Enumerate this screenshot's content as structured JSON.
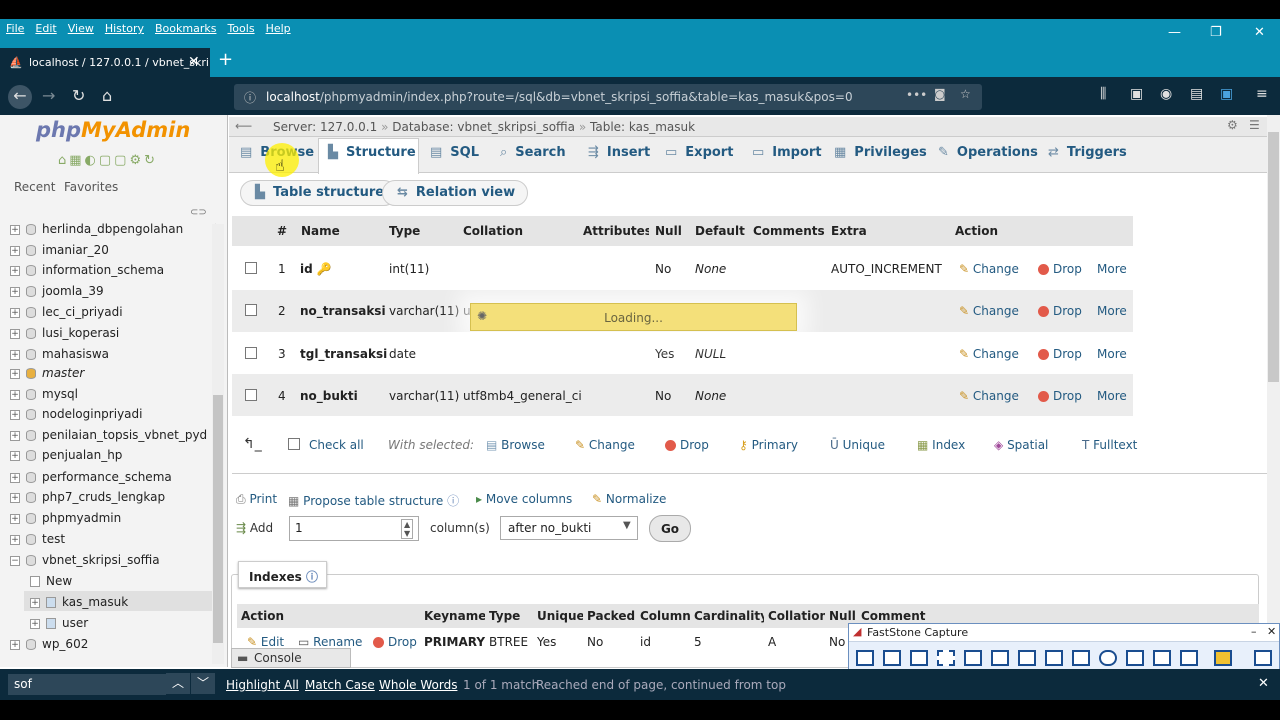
{
  "menu": [
    "File",
    "Edit",
    "View",
    "History",
    "Bookmarks",
    "Tools",
    "Help"
  ],
  "tab_title": "localhost / 127.0.0.1 / vbnet_skripsi_soffia",
  "url_host": "localhost",
  "url_path": "/phpmyadmin/index.php?route=/sql&db=vbnet_skripsi_soffia&table=kas_masuk&pos=0",
  "logo": {
    "php": "php",
    "my": "MyAdmin"
  },
  "sidebar": {
    "recent": "Recent",
    "favorites": "Favorites",
    "dbs": [
      "herlinda_dbpengolahan",
      "imaniar_20",
      "information_schema",
      "joomla_39",
      "lec_ci_priyadi",
      "lusi_koperasi",
      "mahasiswa",
      "master",
      "mysql",
      "nodeloginpriyadi",
      "penilaian_topsis_vbnet_pyd",
      "penjualan_hp",
      "performance_schema",
      "php7_cruds_lengkap",
      "phpmyadmin",
      "test",
      "vbnet_skripsi_soffia",
      "New",
      "kas_masuk",
      "user",
      "wp_602"
    ]
  },
  "breadcrumb": {
    "server": "Server: 127.0.0.1",
    "database": "Database: vbnet_skripsi_soffia",
    "table": "Table: kas_masuk"
  },
  "tabs": [
    "Browse",
    "Structure",
    "SQL",
    "Search",
    "Insert",
    "Export",
    "Import",
    "Privileges",
    "Operations",
    "Triggers"
  ],
  "subtabs": [
    "Table structure",
    "Relation view"
  ],
  "columns": [
    "#",
    "Name",
    "Type",
    "Collation",
    "Attributes",
    "Null",
    "Default",
    "Comments",
    "Extra",
    "Action"
  ],
  "rows": [
    {
      "n": "1",
      "name": "id",
      "type": "int(11)",
      "collation": "",
      "null": "No",
      "default": "None",
      "extra": "AUTO_INCREMENT"
    },
    {
      "n": "2",
      "name": "no_transaksi",
      "type": "varchar(11)",
      "collation": "u",
      "null": "",
      "default": "",
      "extra": ""
    },
    {
      "n": "3",
      "name": "tgl_transaksi",
      "type": "date",
      "collation": "",
      "null": "Yes",
      "default": "NULL",
      "extra": ""
    },
    {
      "n": "4",
      "name": "no_bukti",
      "type": "varchar(11)",
      "collation": "utf8mb4_general_ci",
      "null": "No",
      "default": "None",
      "extra": ""
    }
  ],
  "actions": {
    "change": "Change",
    "drop": "Drop",
    "more": "More"
  },
  "loading": "Loading...",
  "bulk": {
    "check_all": "Check all",
    "with_selected": "With selected:",
    "items": [
      "Browse",
      "Change",
      "Drop",
      "Primary",
      "Unique",
      "Index",
      "Spatial",
      "Fulltext"
    ]
  },
  "tools": {
    "print": "Print",
    "propose": "Propose table structure",
    "move": "Move columns",
    "normalize": "Normalize"
  },
  "add": {
    "label": "Add",
    "value": "1",
    "columns": "column(s)",
    "after": "after no_bukti",
    "go": "Go"
  },
  "indexes": {
    "title": "Indexes",
    "headers": [
      "Action",
      "Keyname",
      "Type",
      "Unique",
      "Packed",
      "Column",
      "Cardinality",
      "Collation",
      "Null",
      "Comment"
    ],
    "row": {
      "edit": "Edit",
      "rename": "Rename",
      "drop": "Drop",
      "keyname": "PRIMARY",
      "type": "BTREE",
      "unique": "Yes",
      "packed": "No",
      "column": "id",
      "cardinality": "5",
      "collation": "A",
      "null": "No"
    }
  },
  "console": "Console",
  "faststone": "FastStone Capture",
  "find": {
    "value": "sof",
    "highlight": "Highlight All",
    "match": "Match Case",
    "whole": "Whole Words",
    "count": "1 of 1 match",
    "status": "Reached end of page, continued from top"
  }
}
